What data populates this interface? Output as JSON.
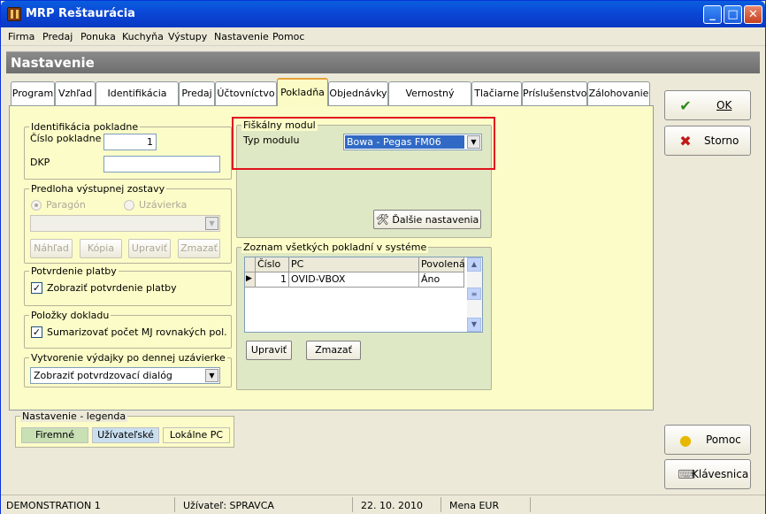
{
  "window": {
    "title": "MRP Reštaurácia"
  },
  "menu": [
    "Firma",
    "Predaj",
    "Ponuka",
    "Kuchyňa",
    "Výstupy",
    "Nastavenie",
    "Pomoc"
  ],
  "header": {
    "title": "Nastavenie"
  },
  "tabs": [
    "Program",
    "Vzhľad",
    "Identifikácia firmy",
    "Predaj",
    "Účtovníctvo",
    "Pokladňa",
    "Objednávky",
    "Vernostný systém",
    "Tlačiarne",
    "Príslušenstvo",
    "Zálohovanie"
  ],
  "active_tab": "Pokladňa",
  "identification": {
    "group_label": "Identifikácia pokladne",
    "number_label": "Číslo pokladne",
    "number_value": "1",
    "dkp_label": "DKP",
    "dkp_value": ""
  },
  "template": {
    "group_label": "Predloha výstupnej zostavy",
    "radio_receipt": "Paragón",
    "radio_closing": "Uzávierka",
    "combo_value": "",
    "btn_preview": "Náhľad",
    "btn_copy": "Kópia",
    "btn_edit": "Upraviť",
    "btn_delete": "Zmazať"
  },
  "payment": {
    "group_label": "Potvrdenie platby",
    "checkbox_label": "Zobraziť potvrdenie platby",
    "checked": true
  },
  "items": {
    "group_label": "Položky dokladu",
    "checkbox_label": "Sumarizovať počet MJ rovnakých pol.",
    "checked": true
  },
  "expense": {
    "group_label": "Vytvorenie výdajky po dennej uzávierke",
    "combo_value": "Zobraziť potvrdzovací dialóg"
  },
  "fiscal": {
    "group_label": "Fiškálny modul",
    "type_label": "Typ modulu",
    "type_value": "Bowa - Pegas FM06",
    "more_settings": "Ďalšie nastavenia"
  },
  "registers": {
    "group_label": "Zoznam všetkých pokladní v systéme",
    "columns": [
      "Číslo",
      "PC",
      "Povolená"
    ],
    "rows": [
      {
        "number": "1",
        "pc": "OVID-VBOX",
        "enabled": "Áno"
      }
    ],
    "btn_edit": "Upraviť",
    "btn_delete": "Zmazať"
  },
  "side_buttons": {
    "ok": "OK",
    "cancel": "Storno",
    "help": "Pomoc",
    "keyboard": "Klávesnica"
  },
  "legend": {
    "label": "Nastavenie - legenda",
    "company": "Firemné",
    "user": "Užívateľské",
    "local": "Lokálne PC"
  },
  "colors": {
    "company": "#c8e0b4",
    "user": "#c9dff0",
    "local": "#fcfcc8",
    "highlight": "#e0141e"
  },
  "status": {
    "mode": "DEMONSTRATION 1",
    "user": "Užívateľ: SPRAVCA",
    "date": "22. 10. 2010",
    "currency": "Mena EUR"
  }
}
